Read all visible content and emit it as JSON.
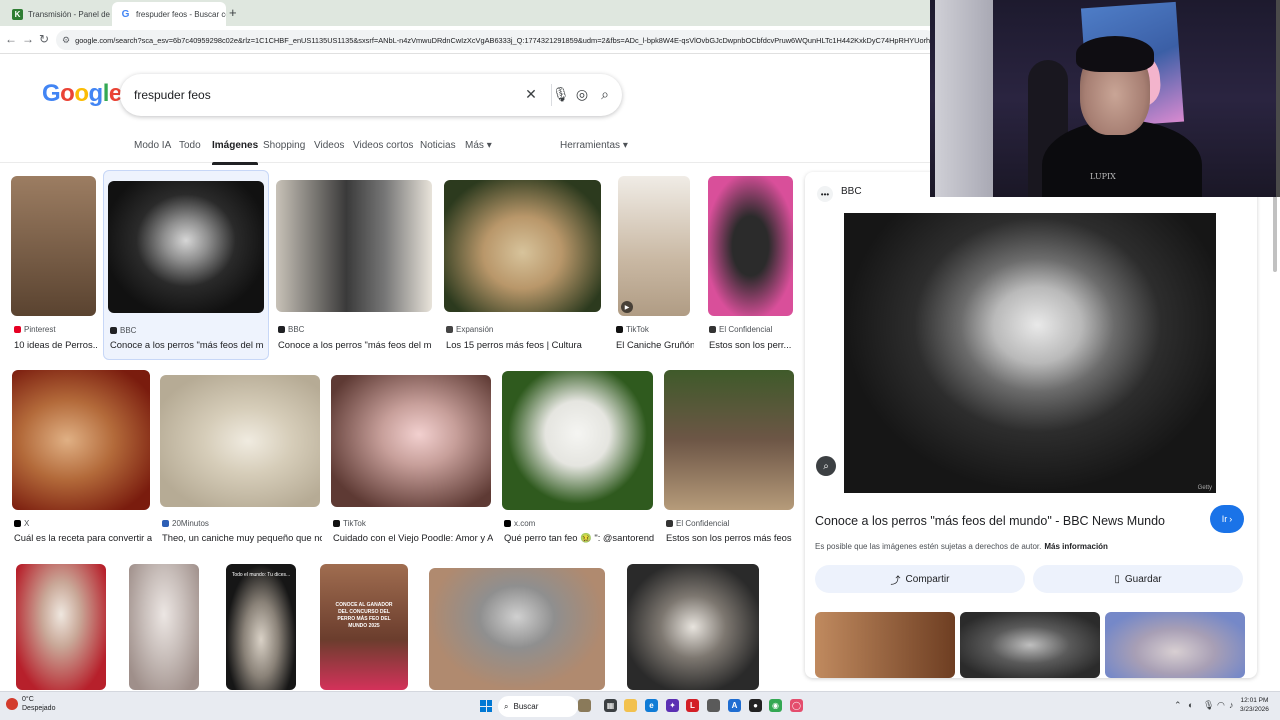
{
  "browser": {
    "tabs": [
      {
        "title": "Transmisión - Panel de control",
        "icon": "stream-panel-icon"
      },
      {
        "title": "frespuder feos - Buscar con Google",
        "icon": "google-g-icon"
      }
    ],
    "url": "google.com/search?sca_esv=6b7c40959298c02e&rlz=1C1CHBF_enUS1135US1135&sxsrf=ANbL-n4zVmwuDRdnCwIzXcVgAB6333j_Q:1774321291859&udm=2&fbs=ADc_l-bpk8W4E-qsVlOvbGJcDwpnbOCbfdcvPruw6WQunHLTc1H442KxkDyC74HpRHYUorhqWu6eEK7aBAtTZpD8FGRodoPqvtwyX"
  },
  "search": {
    "query": "frespuder feos",
    "tabs": [
      "Modo IA",
      "Todo",
      "Imágenes",
      "Shopping",
      "Videos",
      "Videos cortos",
      "Noticias",
      "Más",
      "Herramientas"
    ],
    "active_tab": "Imágenes"
  },
  "grid": {
    "row1": [
      {
        "source": "Pinterest",
        "title": "10 ideas de Perros...",
        "src_color": "#e60023",
        "colors": [
          "#5a4330",
          "#9c7d62"
        ]
      },
      {
        "source": "BBC",
        "title": "Conoce a los perros \"más feos del mu...",
        "src_color": "#202124",
        "colors": [
          "#1a1a1a",
          "#8f8f8f"
        ]
      },
      {
        "source": "BBC",
        "title": "Conoce a los perros \"más feos del mu...",
        "src_color": "#202124",
        "colors": [
          "#3a3a3a",
          "#c8c2b8"
        ]
      },
      {
        "source": "Expansión",
        "title": "Los 15 perros más feos | Cultura",
        "src_color": "#444444",
        "colors": [
          "#2c3a1e",
          "#d7c39b"
        ]
      },
      {
        "source": "TikTok",
        "title": "El Caniche Gruñón...",
        "src_color": "#111111",
        "colors": [
          "#f0ece6",
          "#b09c84"
        ]
      },
      {
        "source": "El Confidencial",
        "title": "Estos son los perr...",
        "src_color": "#333333",
        "colors": [
          "#d94f9a",
          "#2b2b2b"
        ]
      }
    ],
    "row2": [
      {
        "source": "X",
        "title": "Cuál es la receta para convertir a...",
        "src_color": "#000000",
        "colors": [
          "#7a1c0e",
          "#e0b084"
        ]
      },
      {
        "source": "20Minutos",
        "title": "Theo, un caniche muy pequeño que no...",
        "src_color": "#2d5fb5",
        "colors": [
          "#b6ab95",
          "#f0ebe0"
        ]
      },
      {
        "source": "TikTok",
        "title": "Cuidado con el Viejo Poodle: Amor y At...",
        "src_color": "#111111",
        "colors": [
          "#5e3a34",
          "#f2d0cf"
        ]
      },
      {
        "source": "x.com",
        "title": "Qué perro tan feo 🤢 \": @santorend...",
        "src_color": "#000000",
        "colors": [
          "#2f5a1e",
          "#f5f5f2"
        ]
      },
      {
        "source": "El Confidencial",
        "title": "Estos son los perros más feos ...",
        "src_color": "#333333",
        "colors": [
          "#3f5a2a",
          "#6d5646"
        ]
      }
    ],
    "row3": [
      {
        "colors": [
          "#b7202b",
          "#efe7df"
        ]
      },
      {
        "colors": [
          "#9f8f8a",
          "#ece6e3"
        ]
      },
      {
        "colors": [
          "#161616",
          "#d9d1c6"
        ],
        "text": "Todo el mundo: Tu dices..."
      },
      {
        "colors": [
          "#6b3d2d",
          "#a06d50"
        ],
        "text": "CONOCE AL GANADOR DEL CONCURSO DEL PERRO MÁS FEO DEL MUNDO 2025"
      },
      {
        "colors": [
          "#b08a6f",
          "#d0d0d0"
        ]
      },
      {
        "colors": [
          "#2a2a2a",
          "#e8e4de"
        ]
      }
    ]
  },
  "panel": {
    "source": "BBC",
    "title": "Conoce a los perros \"más feos del mundo\" - BBC News Mundo",
    "go_label": "Ir",
    "notice": "Es posible que las imágenes estén sujetas a derechos de autor.",
    "more_info": "Más información",
    "share_label": "Compartir",
    "save_label": "Guardar",
    "credit": "Getty",
    "related_colors": [
      [
        "#6e3e22",
        "#c08a5f"
      ],
      [
        "#2b2b2b",
        "#bfbfbf"
      ],
      [
        "#7588c8",
        "#d8cfd2"
      ]
    ]
  },
  "taskbar": {
    "temp": "0°C",
    "weather": "Despejado",
    "search_label": "Buscar",
    "time": "12:01 PM",
    "date": "3/23/2026"
  },
  "webcam": {
    "shirt_text": "LUPIX"
  }
}
